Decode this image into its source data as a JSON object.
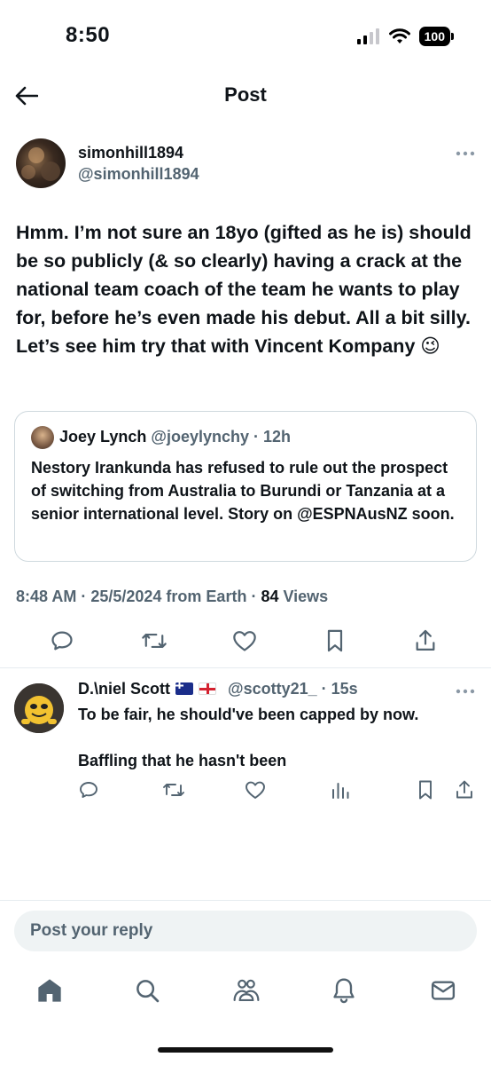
{
  "status_bar": {
    "time": "8:50",
    "battery": "100"
  },
  "nav": {
    "title": "Post"
  },
  "post": {
    "author_name": "simonhill1894",
    "author_handle": "@simonhill1894",
    "text": "Hmm. I’m not sure an 18yo (gifted as he is) should be so publicly (& so clearly) having a crack at the national team coach of the team he wants to play for, before he’s even made his debut. All a bit silly. Let’s see him try that with Vincent Kompany 😉",
    "quote": {
      "name": "Joey Lynch",
      "handle_time": "@joeylynchy · 12h",
      "text": "Nestory Irankunda has refused to rule out the prospect of switching from Australia to Burundi or Tanzania at a senior international level. Story on @ESPNAusNZ soon."
    },
    "meta": "8:48 AM · 25/5/2024 from Earth · ",
    "views_count": "84",
    "views_label": " Views"
  },
  "reply": {
    "name": "D.\\niel Scott",
    "handle_time": "@scotty21_ · 15s",
    "line1": "To be fair, he should've been capped by now.",
    "line2": "Baffling that he hasn't been"
  },
  "reply_input": {
    "placeholder": "Post your reply"
  },
  "icons": {
    "back": "back-arrow-icon",
    "comment": "comment-icon",
    "repost": "repost-icon",
    "like": "heart-icon",
    "bookmark": "bookmark-icon",
    "share": "share-icon",
    "views": "views-bar-icon",
    "home": "home-icon",
    "search": "search-icon",
    "communities": "communities-icon",
    "notifications": "bell-icon",
    "messages": "mail-icon"
  },
  "colors": {
    "text": "#0f1419",
    "secondary": "#536471",
    "icon": "#536471",
    "border": "#cfd9de",
    "input_bg": "#eff3f4"
  }
}
